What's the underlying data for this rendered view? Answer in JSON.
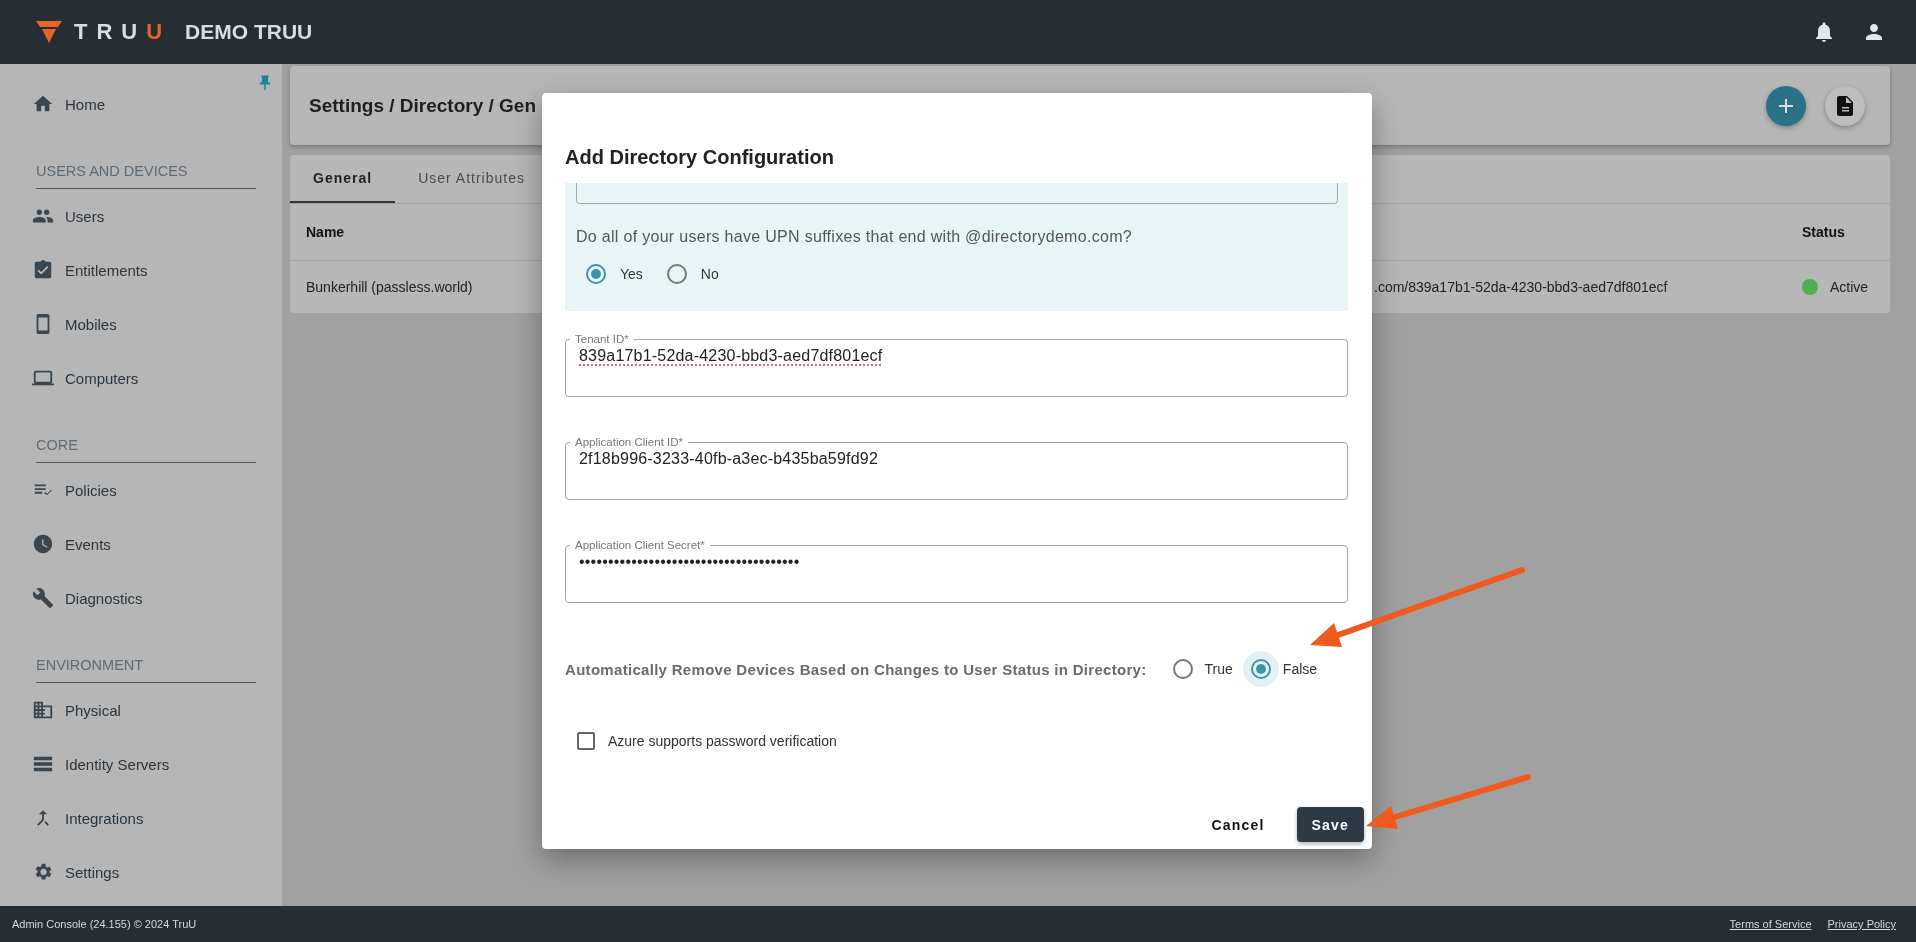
{
  "header": {
    "logo": {
      "text": "TRU",
      "accent": "U"
    },
    "org": "DEMO TRUU"
  },
  "sidebar": {
    "items": [
      {
        "kind": "item",
        "label": "Home"
      },
      {
        "kind": "section",
        "label": "USERS AND DEVICES"
      },
      {
        "kind": "item",
        "label": "Users"
      },
      {
        "kind": "item",
        "label": "Entitlements"
      },
      {
        "kind": "item",
        "label": "Mobiles"
      },
      {
        "kind": "item",
        "label": "Computers"
      },
      {
        "kind": "section",
        "label": "CORE"
      },
      {
        "kind": "item",
        "label": "Policies"
      },
      {
        "kind": "item",
        "label": "Events"
      },
      {
        "kind": "item",
        "label": "Diagnostics"
      },
      {
        "kind": "section",
        "label": "ENVIRONMENT"
      },
      {
        "kind": "item",
        "label": "Physical"
      },
      {
        "kind": "item",
        "label": "Identity Servers"
      },
      {
        "kind": "item",
        "label": "Integrations"
      },
      {
        "kind": "item",
        "label": "Settings"
      }
    ]
  },
  "page": {
    "title": "Settings / Directory / Gen",
    "tabs": [
      {
        "label": "General",
        "selected": true
      },
      {
        "label": "User Attributes",
        "selected": false
      }
    ],
    "table": {
      "columns": [
        {
          "label": "Name"
        },
        {
          "label": "Status"
        }
      ],
      "rows": [
        {
          "name": "Bunkerhill (passless.world)",
          "column_2": ".com/839a17b1-52da-4230-bbd3-aed7df801ecf",
          "status": "Active",
          "color": "#4caf50"
        }
      ]
    }
  },
  "dialog": {
    "title": "Add Directory Configuration",
    "upn_question": "Do all of your users have UPN suffixes that end with @directorydemo.com?",
    "upn_options": [
      {
        "label": "Yes",
        "selected": true
      },
      {
        "label": "No",
        "selected": false
      }
    ],
    "fields": [
      {
        "label": "Tenant ID*",
        "value": "839a17b1-52da-4230-bbd3-aed7df801ecf",
        "spellcheck_error": true
      },
      {
        "label": "Application Client ID*",
        "value": "2f18b996-3233-40fb-a3ec-b435ba59fd92",
        "spellcheck_error": false
      },
      {
        "label": "Application Client Secret*",
        "value": "••••••••••••••••••••••••••••••••••••••",
        "spellcheck_error": false
      }
    ],
    "auto_remove": {
      "label": "Automatically Remove Devices Based on Changes to User Status in Directory:",
      "options": [
        {
          "label": "True",
          "selected": false,
          "focused": false
        },
        {
          "label": "False",
          "selected": true,
          "focused": true
        }
      ]
    },
    "checkbox": {
      "label": "Azure supports password verification",
      "checked": false
    },
    "buttons": [
      {
        "label": "Cancel",
        "kind": "text"
      },
      {
        "label": "Save",
        "kind": "primary"
      }
    ]
  },
  "footer": {
    "text": "Admin Console (24.155) © 2024 TruU",
    "links": [
      "Terms of Service",
      "Privacy Policy"
    ]
  }
}
